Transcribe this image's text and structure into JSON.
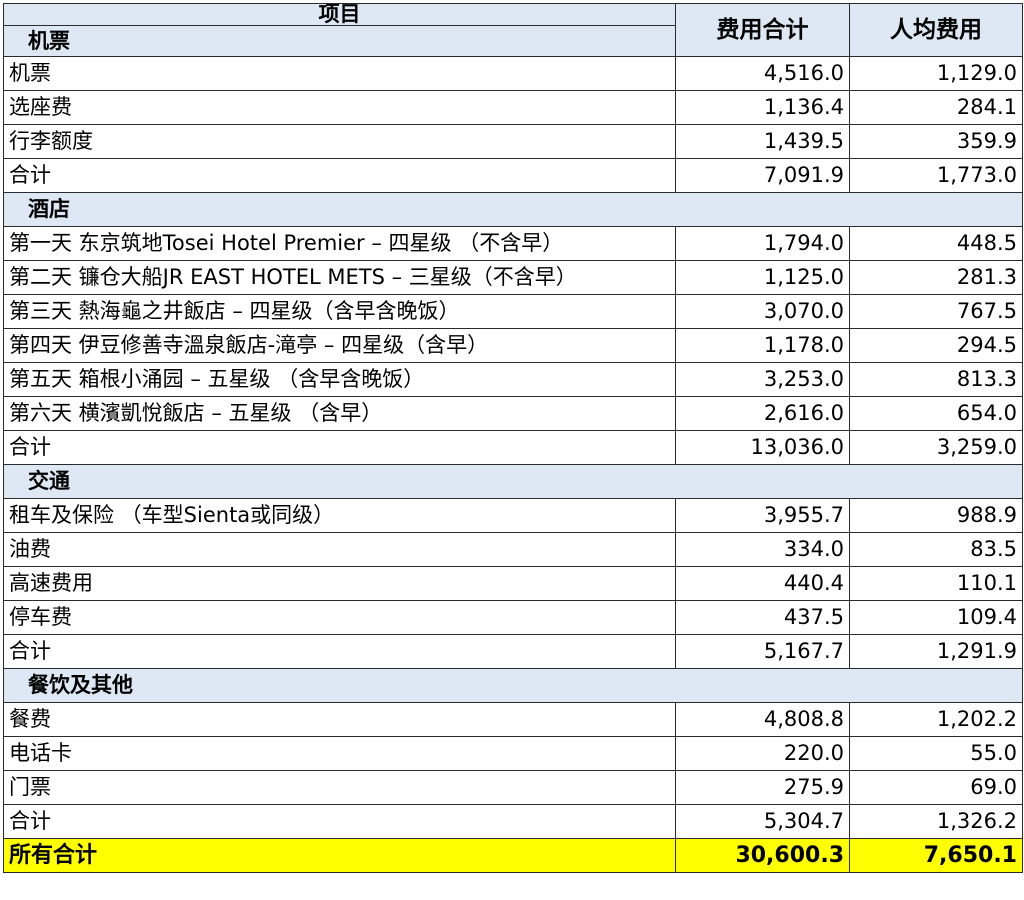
{
  "header": {
    "item_label": "项目",
    "total_label": "费用合计",
    "per_person_label": "人均费用"
  },
  "sections": [
    {
      "title": "机票",
      "rows": [
        {
          "item": "机票",
          "total": "4,516.0",
          "per": "1,129.0"
        },
        {
          "item": "选座费",
          "total": "1,136.4",
          "per": "284.1"
        },
        {
          "item": "行李额度",
          "total": "1,439.5",
          "per": "359.9"
        }
      ],
      "subtotal": {
        "item": "合计",
        "total": "7,091.9",
        "per": "1,773.0"
      }
    },
    {
      "title": "酒店",
      "rows": [
        {
          "item": "第一天 东京筑地Tosei Hotel Premier – 四星级 （不含早）",
          "total": "1,794.0",
          "per": "448.5"
        },
        {
          "item": "第二天 镰仓大船JR EAST HOTEL METS – 三星级（不含早）",
          "total": "1,125.0",
          "per": "281.3"
        },
        {
          "item": "第三天 熱海龜之井飯店 – 四星级（含早含晚饭）",
          "total": "3,070.0",
          "per": "767.5"
        },
        {
          "item": "第四天 伊豆修善寺溫泉飯店-滝亭 – 四星级（含早）",
          "total": "1,178.0",
          "per": "294.5"
        },
        {
          "item": "第五天 箱根小涌园 – 五星级 （含早含晚饭）",
          "total": "3,253.0",
          "per": "813.3"
        },
        {
          "item": "第六天 横濱凱悅飯店 – 五星级 （含早）",
          "total": "2,616.0",
          "per": "654.0"
        }
      ],
      "subtotal": {
        "item": "合计",
        "total": "13,036.0",
        "per": "3,259.0"
      }
    },
    {
      "title": "交通",
      "rows": [
        {
          "item": "租车及保险 （车型Sienta或同级）",
          "total": "3,955.7",
          "per": "988.9"
        },
        {
          "item": "油费",
          "total": "334.0",
          "per": "83.5"
        },
        {
          "item": "高速费用",
          "total": "440.4",
          "per": "110.1"
        },
        {
          "item": "停车费",
          "total": "437.5",
          "per": "109.4"
        }
      ],
      "subtotal": {
        "item": "合计",
        "total": "5,167.7",
        "per": "1,291.9"
      }
    },
    {
      "title": "餐饮及其他",
      "rows": [
        {
          "item": "餐费",
          "total": "4,808.8",
          "per": "1,202.2"
        },
        {
          "item": "电话卡",
          "total": "220.0",
          "per": "55.0"
        },
        {
          "item": "门票",
          "total": "275.9",
          "per": "69.0"
        }
      ],
      "subtotal": {
        "item": "合计",
        "total": "5,304.7",
        "per": "1,326.2"
      }
    }
  ],
  "grand_total": {
    "item": "所有合计",
    "total": "30,600.3",
    "per": "7,650.1"
  },
  "colors": {
    "section_bg": "#dde8f4",
    "grand_bg": "#ffff00",
    "border": "#2b2b2b"
  }
}
